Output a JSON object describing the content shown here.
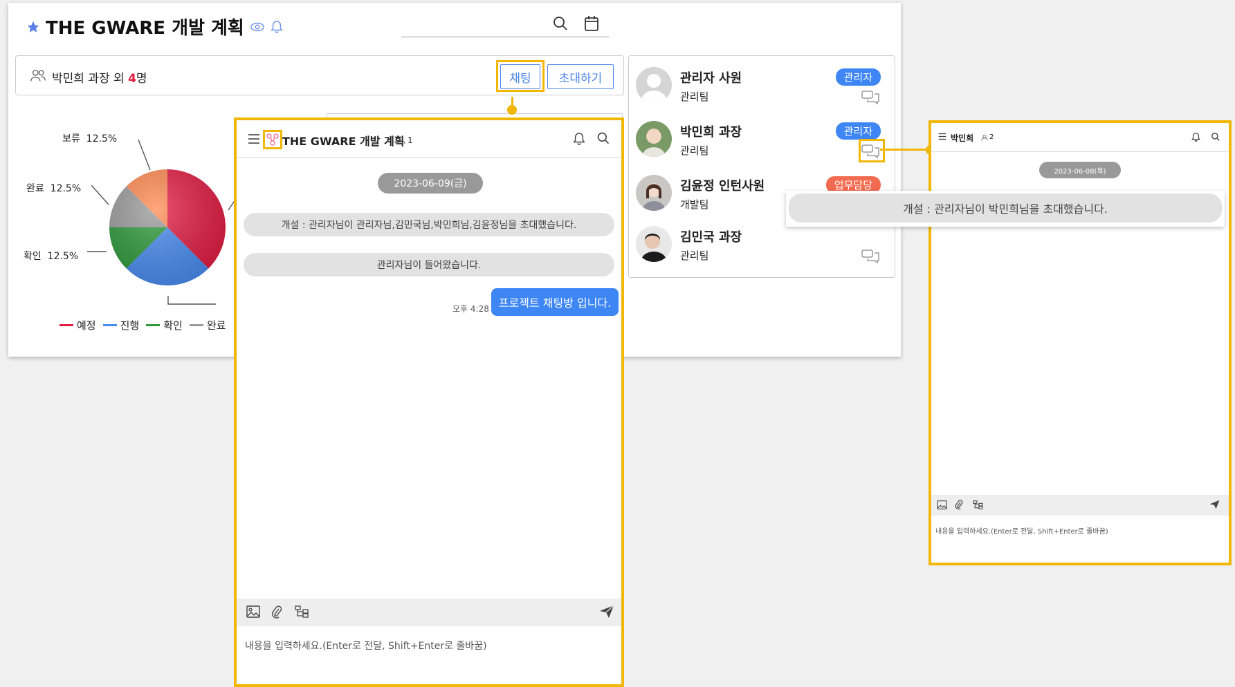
{
  "project": {
    "title": "THE GWARE 개발 계획",
    "members_prefix": "박민희 과장 외 ",
    "members_count": "4",
    "members_suffix": "명",
    "chat_button": "채팅",
    "invite_button": "초대하기"
  },
  "chart_data": {
    "type": "pie",
    "slices": [
      {
        "name": "예정",
        "value": 37.5,
        "color": "#e31d44"
      },
      {
        "name": "진행",
        "value": 25.0,
        "color": "#4a8cf0"
      },
      {
        "name": "확인",
        "value": 12.5,
        "color": "#2e9a3c"
      },
      {
        "name": "완료",
        "value": 12.5,
        "color": "#9a9a9a"
      },
      {
        "name": "보류",
        "value": 12.5,
        "color": "#ff8a52"
      }
    ],
    "labels": {
      "boryu": {
        "name": "보류",
        "pct": "12.5%"
      },
      "wanryo": {
        "name": "완료",
        "pct": "12.5%"
      },
      "hwagin": {
        "name": "확인",
        "pct": "12.5%"
      }
    },
    "legend": [
      "예정",
      "진행",
      "확인",
      "완료"
    ],
    "legend_placement": "bottom"
  },
  "users": [
    {
      "name": "관리자 사원",
      "team": "관리팀",
      "badge": "관리자",
      "badge_color": "#3d86f4"
    },
    {
      "name": "박민희 과장",
      "team": "관리팀",
      "badge": "관리자",
      "badge_color": "#3d86f4"
    },
    {
      "name": "김윤정 인턴사원",
      "team": "개발팀",
      "badge": "업무담당",
      "badge_color": "#f26a4f"
    },
    {
      "name": "김민국 과장",
      "team": "관리팀"
    }
  ],
  "chat1": {
    "title": "THE GWARE 개발 계획",
    "member_count": "1",
    "date": "2023-06-09(금)",
    "system_messages": [
      "개설 : 관리자님이 관리자님,김민국님,박민희님,김윤정님을 초대했습니다.",
      "관리자님이 들어왔습니다."
    ],
    "my_message": {
      "time": "오후 4:28",
      "text": "프로젝트 채팅방 입니다."
    },
    "placeholder": "내용을 입력하세요.(Enter로 전달, Shift+Enter로 줄바꿈)"
  },
  "chat2": {
    "title": "박민희",
    "member_count": "2",
    "date": "2023-06-08(목)",
    "system_message": "개설 : 관리자님이 박민희님을 초대했습니다.",
    "placeholder": "내용을 입력하세요.(Enter로 전달, Shift+Enter로 줄바꿈)"
  },
  "colors": {
    "highlight": "#f2b705",
    "accent": "#3d86f4"
  }
}
